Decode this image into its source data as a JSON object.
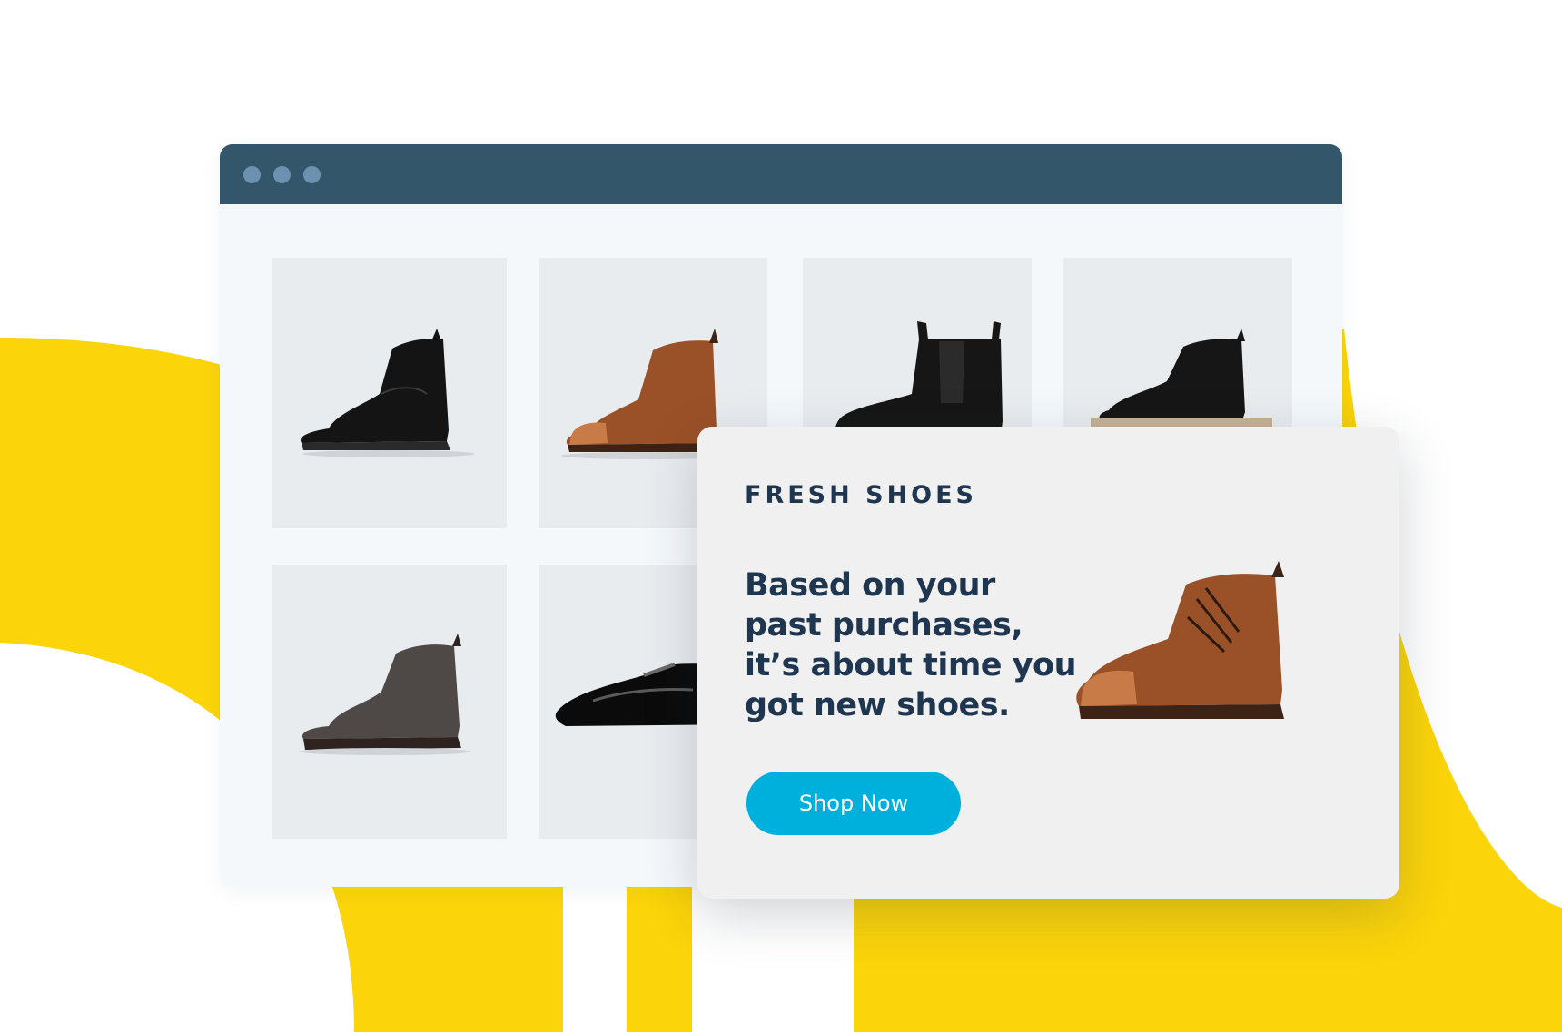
{
  "window": {
    "controls": [
      "window-dot-icon",
      "window-dot-icon",
      "window-dot-icon"
    ]
  },
  "product_grid": {
    "items": [
      {
        "icon": "black-leather-boot-image"
      },
      {
        "icon": "brown-leather-boot-image"
      },
      {
        "icon": "black-chelsea-boot-image"
      },
      {
        "icon": "black-boot-on-sole-image"
      },
      {
        "icon": "grey-suede-boot-image"
      },
      {
        "icon": "black-patent-shoe-image"
      }
    ]
  },
  "promo": {
    "eyebrow": "FRESH SHOES",
    "headline": {
      "line1": "Based on your",
      "line2": "past purchases,",
      "line3": "it’s about time you",
      "line4": "got new shoes."
    },
    "button_label": "Shop Now",
    "image": "brown-leather-boot-image"
  },
  "colors": {
    "accent_yellow": "#fbd40a",
    "titlebar": "#34566b",
    "button": "#00b0dc",
    "text_dark": "#1f3651"
  }
}
